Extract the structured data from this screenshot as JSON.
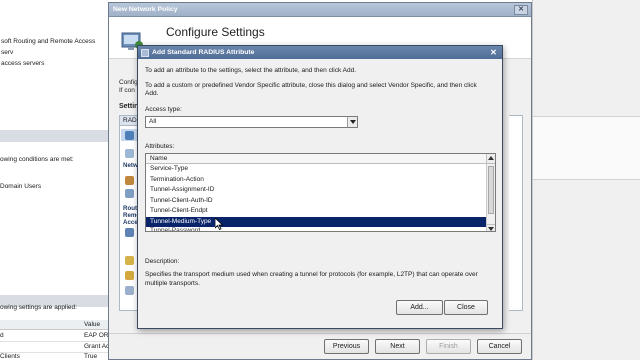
{
  "background": {
    "top_lines": [
      "soft Routing and Remote Access serv",
      "access servers"
    ],
    "conditions_text": "owing conditions are met:",
    "domain_users": "Domain Users",
    "settings_text": "owing settings are applied:",
    "table_header_value": "Value",
    "rows": [
      {
        "left": "d",
        "value": "EAP OR"
      },
      {
        "left": "",
        "value": "Grant Ac"
      },
      {
        "left": "Clients",
        "value": "True"
      }
    ]
  },
  "policy_window": {
    "title": "New Network Policy",
    "header_title": "Configure Settings",
    "side_text_1": "Configu",
    "side_text_2": "If con",
    "settings_label": "Settin",
    "panel_header": "RADIU",
    "group_network": "Netw",
    "group_routing": "Routi",
    "group_remote": "Remo",
    "group_access": "Acce",
    "buttons": {
      "previous": "Previous",
      "next": "Next",
      "finish": "Finish",
      "cancel": "Cancel"
    }
  },
  "dialog": {
    "title": "Add Standard RADIUS Attribute",
    "instruction_1": "To add an attribute to the settings, select the attribute, and then click Add.",
    "instruction_2a": "To add a custom or predefined Vendor Specific attribute, close this dialog and select Vendor Specific, and then click",
    "instruction_2b": "Add.",
    "access_type_label": "Access type:",
    "access_type_value": "All",
    "attributes_label": "Attributes:",
    "column_name": "Name",
    "attributes": [
      "Service-Type",
      "Termination-Action",
      "Tunnel-Assignment-ID",
      "Tunnel-Client-Auth-ID",
      "Tunnel-Client-Endpt",
      "Tunnel-Medium-Type",
      "Tunnel-Password"
    ],
    "selected_attribute": "Tunnel-Medium-Type",
    "description_label": "Description:",
    "description_text": "Specifies the transport medium used when creating a tunnel for protocols (for example, L2TP) that can operate over multiple transports.",
    "buttons": {
      "add": "Add...",
      "close": "Close"
    }
  }
}
